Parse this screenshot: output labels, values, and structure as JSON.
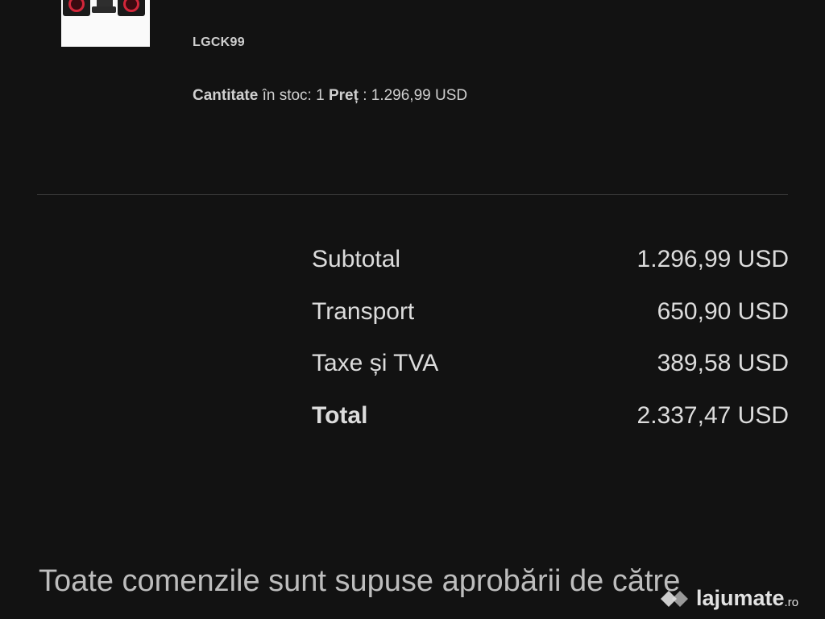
{
  "product": {
    "sku": "LGCK99",
    "stock_label": "Cantitate",
    "stock_text": " în stoc: 1 ",
    "price_label": "Preț",
    "price_text": " : 1.296,99 USD"
  },
  "summary": {
    "rows": [
      {
        "label": "Subtotal",
        "value": "1.296,99 USD"
      },
      {
        "label": "Transport",
        "value": "650,90 USD"
      },
      {
        "label": "Taxe și TVA",
        "value": "389,58 USD"
      },
      {
        "label": "Total",
        "value": "2.337,47 USD"
      }
    ]
  },
  "footer": {
    "text": "Toate comenzile sunt supuse aprobării de către"
  },
  "watermark": {
    "text": "lajumate",
    "suffix": ".ro",
    "icon": "lajumate-logo-icon"
  },
  "colors": {
    "background": "#121212",
    "text": "#d6d6d6",
    "speaker_accent": "#d2263a"
  }
}
